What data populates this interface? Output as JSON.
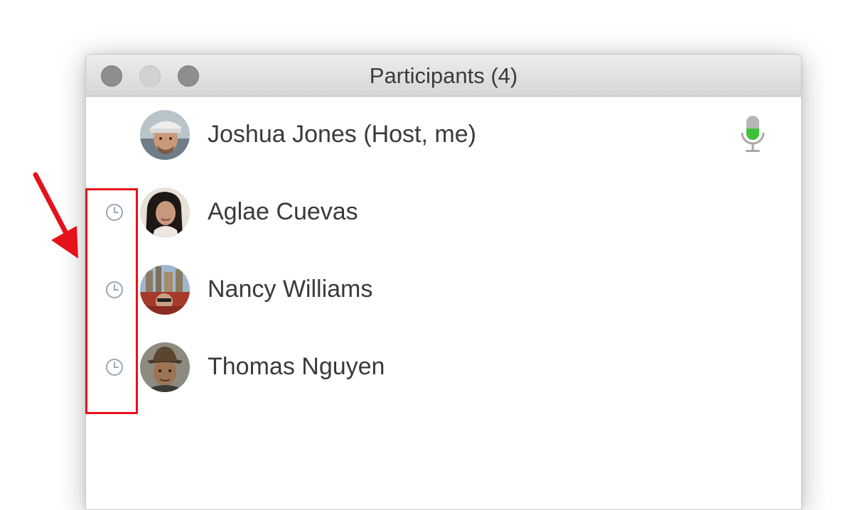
{
  "window": {
    "title": "Participants (4)"
  },
  "participants": [
    {
      "name": "Joshua Jones (Host, me)",
      "avatar": "man-white-cap-avatar",
      "status_icon": "",
      "mic": "mic-unmuted-active"
    },
    {
      "name": "Aglae Cuevas",
      "avatar": "woman-dark-hair-avatar",
      "status_icon": "clock-icon"
    },
    {
      "name": "Nancy Williams",
      "avatar": "woman-sunglasses-city-avatar",
      "status_icon": "clock-icon"
    },
    {
      "name": "Thomas Nguyen",
      "avatar": "man-hat-avatar",
      "status_icon": "clock-icon"
    }
  ],
  "annotation": {
    "box_color": "#e5121b",
    "arrow_color": "#e5121b"
  },
  "colors": {
    "mic_active": "#3fc23a",
    "clock_icon": "#9aa8b6"
  }
}
